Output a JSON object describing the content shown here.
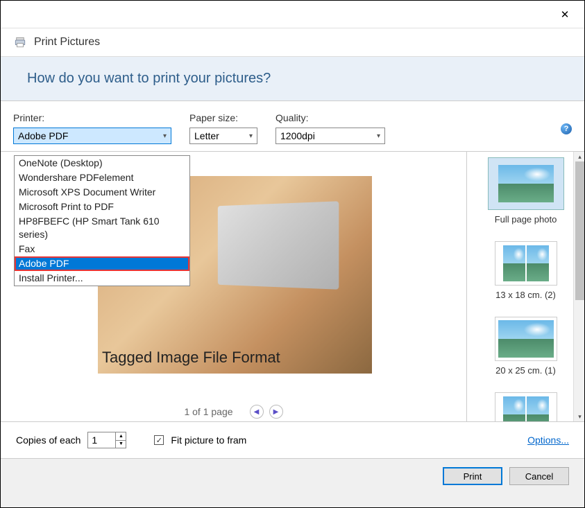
{
  "titlebar": {
    "close": "✕"
  },
  "header": {
    "title": "Print Pictures"
  },
  "banner": {
    "text": "How do you want to print your pictures?"
  },
  "settings": {
    "printer_label": "Printer:",
    "printer_value": "Adobe PDF",
    "paper_label": "Paper size:",
    "paper_value": "Letter",
    "quality_label": "Quality:",
    "quality_value": "1200dpi",
    "help": "?"
  },
  "printer_options": [
    "OneNote (Desktop)",
    "Wondershare PDFelement",
    "Microsoft XPS Document Writer",
    "Microsoft Print to PDF",
    "HP8FBEFC (HP Smart Tank 610 series)",
    "Fax",
    "Adobe PDF",
    "Install Printer..."
  ],
  "printer_selected_index": 6,
  "preview": {
    "caption": "Tagged Image File Format",
    "page_text": "1 of 1 page"
  },
  "layouts": [
    {
      "label": "Full page photo",
      "cols": 1
    },
    {
      "label": "13 x 18 cm. (2)",
      "cols": 2
    },
    {
      "label": "20 x 25 cm. (1)",
      "cols": 1
    },
    {
      "label": "",
      "cols": 2
    }
  ],
  "footer": {
    "copies_label": "Copies of each",
    "copies_value": "1",
    "fit_label": "Fit picture to fram",
    "fit_checked": true,
    "options": "Options...",
    "print": "Print",
    "cancel": "Cancel"
  }
}
